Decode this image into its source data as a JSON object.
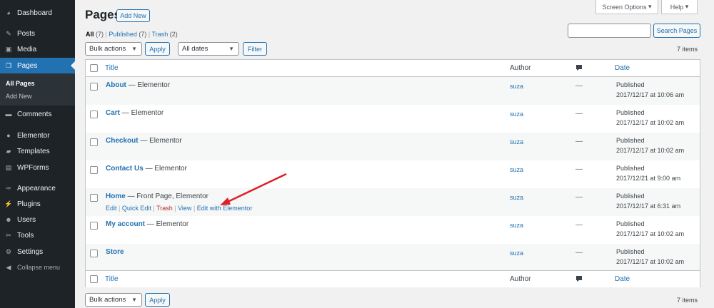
{
  "sidebar": {
    "items": [
      {
        "label": "Dashboard",
        "icon": "dashboard-icon"
      },
      {
        "label": "Posts",
        "icon": "pin-icon"
      },
      {
        "label": "Media",
        "icon": "media-icon"
      },
      {
        "label": "Pages",
        "icon": "pages-icon"
      },
      {
        "label": "Comments",
        "icon": "comment-icon"
      },
      {
        "label": "Elementor",
        "icon": "elementor-icon"
      },
      {
        "label": "Templates",
        "icon": "folder-icon"
      },
      {
        "label": "WPForms",
        "icon": "forms-icon"
      },
      {
        "label": "Appearance",
        "icon": "brush-icon"
      },
      {
        "label": "Plugins",
        "icon": "plugin-icon"
      },
      {
        "label": "Users",
        "icon": "user-icon"
      },
      {
        "label": "Tools",
        "icon": "wrench-icon"
      },
      {
        "label": "Settings",
        "icon": "settings-icon"
      }
    ],
    "submenu": [
      "All Pages",
      "Add New"
    ],
    "collapse_label": "Collapse menu"
  },
  "header": {
    "title": "Pages",
    "add_new": "Add New",
    "screen_options": "Screen Options",
    "help": "Help"
  },
  "views": {
    "all_label": "All",
    "all_count": "(7)",
    "published_label": "Published",
    "published_count": "(7)",
    "trash_label": "Trash",
    "trash_count": "(2)"
  },
  "search": {
    "button": "Search Pages",
    "value": ""
  },
  "toolbar": {
    "bulk_actions": "Bulk actions",
    "apply": "Apply",
    "dates": "All dates",
    "filter": "Filter",
    "items_count": "7 items"
  },
  "columns": {
    "title": "Title",
    "author": "Author",
    "date": "Date"
  },
  "rows": [
    {
      "title": "About",
      "state": "— Elementor",
      "author": "suza",
      "comments": "—",
      "status": "Published",
      "date": "2017/12/17 at 10:06 am"
    },
    {
      "title": "Cart",
      "state": "— Elementor",
      "author": "suza",
      "comments": "—",
      "status": "Published",
      "date": "2017/12/17 at 10:02 am"
    },
    {
      "title": "Checkout",
      "state": "— Elementor",
      "author": "suza",
      "comments": "—",
      "status": "Published",
      "date": "2017/12/17 at 10:02 am"
    },
    {
      "title": "Contact Us",
      "state": "— Elementor",
      "author": "suza",
      "comments": "—",
      "status": "Published",
      "date": "2017/12/21 at 9:00 am"
    },
    {
      "title": "Home",
      "state": "— Front Page, Elementor",
      "author": "suza",
      "comments": "—",
      "status": "Published",
      "date": "2017/12/17 at 6:31 am",
      "actions": {
        "edit": "Edit",
        "quick_edit": "Quick Edit",
        "trash": "Trash",
        "view": "View",
        "edit_elementor": "Edit with Elementor"
      }
    },
    {
      "title": "My account",
      "state": "— Elementor",
      "author": "suza",
      "comments": "—",
      "status": "Published",
      "date": "2017/12/17 at 10:02 am"
    },
    {
      "title": "Store",
      "state": "",
      "author": "suza",
      "comments": "—",
      "status": "Published",
      "date": "2017/12/17 at 10:02 am"
    }
  ],
  "colors": {
    "accent": "#2271b1",
    "sidebar": "#1d2327",
    "arrow": "#dd1f26",
    "trash": "#b32d2e"
  }
}
